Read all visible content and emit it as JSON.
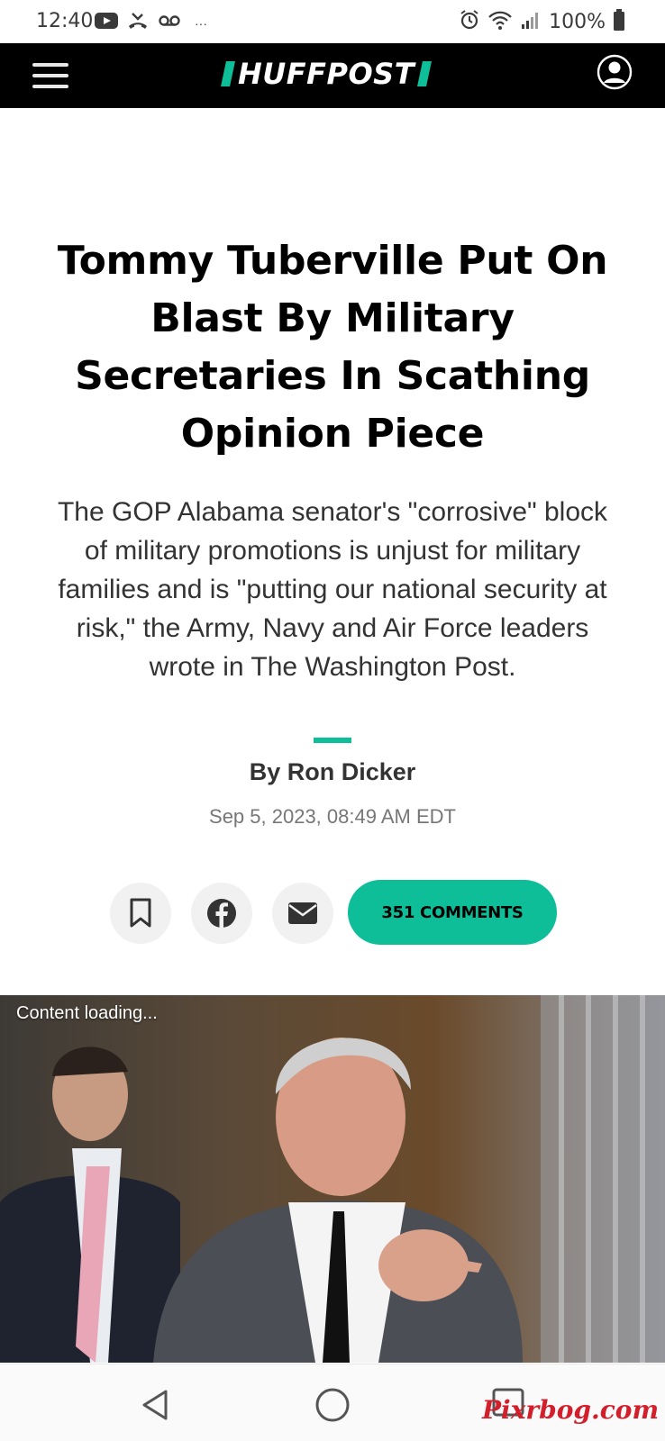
{
  "status_bar": {
    "time": "12:40",
    "battery": "100%",
    "left_icons": [
      "youtube-icon",
      "missed-call-icon",
      "voicemail-icon",
      "more-dots-icon"
    ],
    "right_icons": [
      "alarm-icon",
      "wifi-icon",
      "signal-icon",
      "battery-icon"
    ]
  },
  "header": {
    "logo_text": "HUFFPOST",
    "brand_color": "#0dbe98"
  },
  "article": {
    "headline": "Tommy Tuberville Put On Blast By Military Secretaries In Scathing Opinion Piece",
    "dek": "The GOP Alabama senator's \"corrosive\" block of military promotions is unjust for military families and is \"putting our national security at risk,\" the Army, Navy and Air Force leaders wrote in The Washington Post.",
    "byline": "By Ron Dicker",
    "date": "Sep 5, 2023, 08:49 AM EDT"
  },
  "share": {
    "icons": [
      "bookmark-icon",
      "facebook-icon",
      "email-icon"
    ],
    "comments_label": "351 COMMENTS"
  },
  "hero": {
    "overlay_text": "Content loading..."
  },
  "nav_bar": {
    "watermark": "Pixrbog.com"
  }
}
